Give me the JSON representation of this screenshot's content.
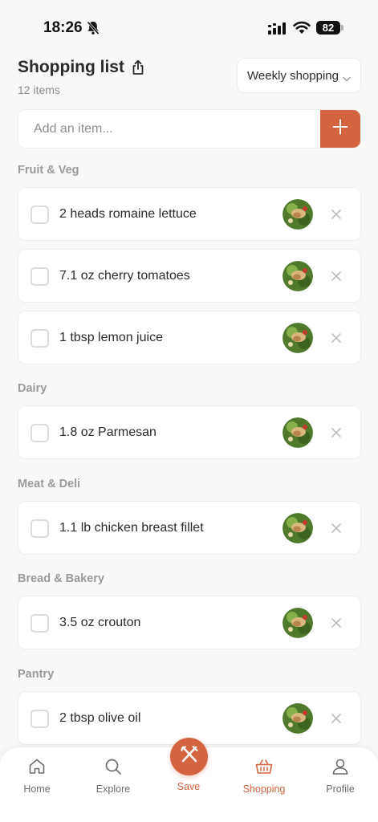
{
  "status_bar": {
    "time": "18:26",
    "battery": "82"
  },
  "header": {
    "title": "Shopping list",
    "item_count": "12 items",
    "list_selector": "Weekly shopping"
  },
  "add_item": {
    "placeholder": "Add an item..."
  },
  "sections": [
    {
      "label": "Fruit & Veg",
      "items": [
        "2 heads romaine lettuce",
        "7.1 oz cherry tomatoes",
        "1 tbsp lemon juice"
      ]
    },
    {
      "label": "Dairy",
      "items": [
        "1.8 oz Parmesan"
      ]
    },
    {
      "label": "Meat & Deli",
      "items": [
        "1.1 lb chicken breast fillet"
      ]
    },
    {
      "label": "Bread & Bakery",
      "items": [
        "3.5 oz crouton"
      ]
    },
    {
      "label": "Pantry",
      "items": [
        "2 tbsp olive oil"
      ]
    }
  ],
  "bottom_nav": {
    "home": "Home",
    "explore": "Explore",
    "save": "Save",
    "shopping": "Shopping",
    "profile": "Profile"
  },
  "colors": {
    "accent": "#d4633f",
    "background": "#f8f8f7",
    "section_label": "#9a9a9a"
  }
}
